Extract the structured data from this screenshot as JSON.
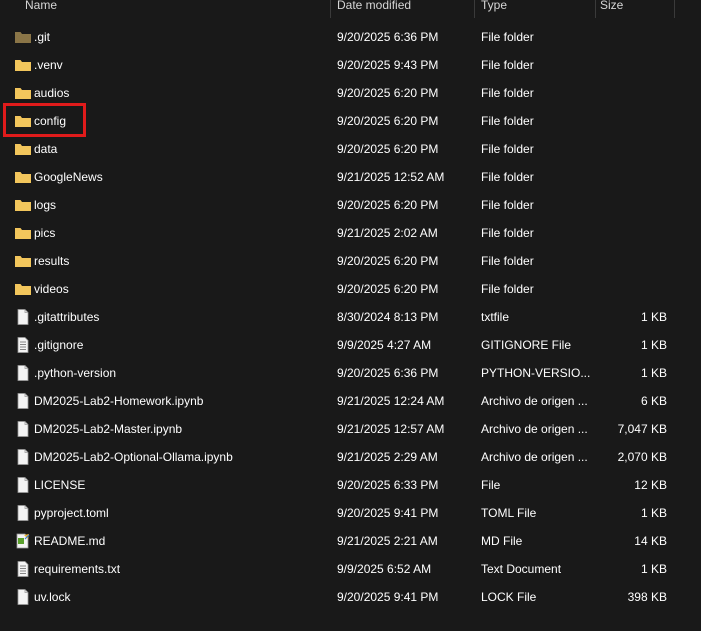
{
  "header": {
    "name": "Name",
    "date_modified": "Date modified",
    "type": "Type",
    "size": "Size"
  },
  "files": [
    {
      "name": ".git",
      "date": "9/20/2025 6:36 PM",
      "type": "File folder",
      "size": "",
      "icon": "folder-icon",
      "hidden": true
    },
    {
      "name": ".venv",
      "date": "9/20/2025 9:43 PM",
      "type": "File folder",
      "size": "",
      "icon": "folder-icon"
    },
    {
      "name": "audios",
      "date": "9/20/2025 6:20 PM",
      "type": "File folder",
      "size": "",
      "icon": "folder-icon"
    },
    {
      "name": "config",
      "date": "9/20/2025 6:20 PM",
      "type": "File folder",
      "size": "",
      "icon": "folder-icon",
      "highlighted": true
    },
    {
      "name": "data",
      "date": "9/20/2025 6:20 PM",
      "type": "File folder",
      "size": "",
      "icon": "folder-icon"
    },
    {
      "name": "GoogleNews",
      "date": "9/21/2025 12:52 AM",
      "type": "File folder",
      "size": "",
      "icon": "folder-icon"
    },
    {
      "name": "logs",
      "date": "9/20/2025 6:20 PM",
      "type": "File folder",
      "size": "",
      "icon": "folder-icon"
    },
    {
      "name": "pics",
      "date": "9/21/2025 2:02 AM",
      "type": "File folder",
      "size": "",
      "icon": "folder-icon"
    },
    {
      "name": "results",
      "date": "9/20/2025 6:20 PM",
      "type": "File folder",
      "size": "",
      "icon": "folder-icon"
    },
    {
      "name": "videos",
      "date": "9/20/2025 6:20 PM",
      "type": "File folder",
      "size": "",
      "icon": "folder-icon"
    },
    {
      "name": ".gitattributes",
      "date": "8/30/2024 8:13 PM",
      "type": "txtfile",
      "size": "1 KB",
      "icon": "blank-file-icon"
    },
    {
      "name": ".gitignore",
      "date": "9/9/2025 4:27 AM",
      "type": "GITIGNORE File",
      "size": "1 KB",
      "icon": "text-file-icon"
    },
    {
      "name": ".python-version",
      "date": "9/20/2025 6:36 PM",
      "type": "PYTHON-VERSIO...",
      "size": "1 KB",
      "icon": "blank-file-icon"
    },
    {
      "name": "DM2025-Lab2-Homework.ipynb",
      "date": "9/21/2025 12:24 AM",
      "type": "Archivo de origen ...",
      "size": "6 KB",
      "icon": "blank-file-icon"
    },
    {
      "name": "DM2025-Lab2-Master.ipynb",
      "date": "9/21/2025 12:57 AM",
      "type": "Archivo de origen ...",
      "size": "7,047 KB",
      "icon": "blank-file-icon"
    },
    {
      "name": "DM2025-Lab2-Optional-Ollama.ipynb",
      "date": "9/21/2025 2:29 AM",
      "type": "Archivo de origen ...",
      "size": "2,070 KB",
      "icon": "blank-file-icon"
    },
    {
      "name": "LICENSE",
      "date": "9/20/2025 6:33 PM",
      "type": "File",
      "size": "12 KB",
      "icon": "blank-file-icon"
    },
    {
      "name": "pyproject.toml",
      "date": "9/20/2025 9:41 PM",
      "type": "TOML File",
      "size": "1 KB",
      "icon": "blank-file-icon"
    },
    {
      "name": "README.md",
      "date": "9/21/2025 2:21 AM",
      "type": "MD File",
      "size": "14 KB",
      "icon": "markdown-file-icon"
    },
    {
      "name": "requirements.txt",
      "date": "9/9/2025 6:52 AM",
      "type": "Text Document",
      "size": "1 KB",
      "icon": "text-file-icon"
    },
    {
      "name": "uv.lock",
      "date": "9/20/2025 9:41 PM",
      "type": "LOCK File",
      "size": "398 KB",
      "icon": "blank-file-icon"
    }
  ],
  "colors": {
    "background": "#191919",
    "folder": "#f2c55c",
    "folder_hidden": "#8a7648",
    "highlight": "#e01b1b"
  }
}
